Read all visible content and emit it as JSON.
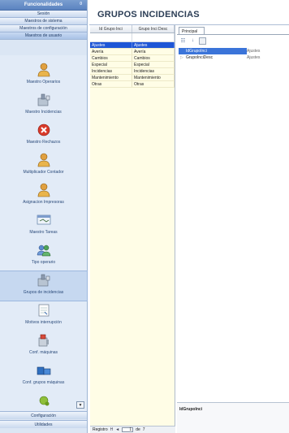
{
  "nav": {
    "header": "Funcionalidades",
    "header_pin": "0",
    "groups": [
      "Sesión",
      "Maestros de sistema",
      "Maestros de configuración",
      "Maestros de usuario"
    ],
    "items": [
      {
        "label": "Maestro Operarios",
        "icon": "user-icon"
      },
      {
        "label": "Maestro Incidencias",
        "icon": "incident-icon"
      },
      {
        "label": "Maestro Rechazos",
        "icon": "reject-icon"
      },
      {
        "label": "Multiplicador Contador",
        "icon": "user-icon"
      },
      {
        "label": "Asignacion Impresoras",
        "icon": "user-icon"
      },
      {
        "label": "Maestro Tareas",
        "icon": "tasks-icon"
      },
      {
        "label": "Tipo operario",
        "icon": "users-icon"
      },
      {
        "label": "Grupos de incidencias",
        "icon": "incident-groups-icon"
      },
      {
        "label": "Motivos interrupción",
        "icon": "document-icon"
      },
      {
        "label": "Conf. máquinas",
        "icon": "machine-icon"
      },
      {
        "label": "Conf. grupos máquinas",
        "icon": "machine-groups-icon"
      },
      {
        "label": "",
        "icon": "partial-icon"
      }
    ],
    "footer": [
      "Configuración",
      "Utilidades"
    ]
  },
  "page_title": "GRUPOS INCIDENCIAS",
  "grid": {
    "columns": [
      "Id Grupo Inci",
      "Grupo Inci Desc"
    ],
    "rows": [
      [
        "Ajustes",
        "Ajustes"
      ],
      [
        "Avería",
        "Avería"
      ],
      [
        "Cambios",
        "Cambios"
      ],
      [
        "Especial",
        "Especial"
      ],
      [
        "Incidencias",
        "Incidencias"
      ],
      [
        "Mantenimiento",
        "Mantenimiento"
      ],
      [
        "Otras",
        "Otras"
      ]
    ],
    "selected_row": 0,
    "pager": {
      "label": "Registro",
      "first": "H",
      "prev": "◄",
      "current": "1",
      "of_label": "de",
      "total": "7"
    }
  },
  "props": {
    "tab": "Principal",
    "rows": [
      {
        "name": "IdGrupoInci",
        "value": "Ajustes"
      },
      {
        "name": "GrupoInciDesc",
        "value": "Ajustes"
      }
    ],
    "description_title": "IdGrupoInci"
  },
  "colors": {
    "selection": "#1e56d6",
    "grid_bg": "#fffde6",
    "nav_bg": "#dbe6f4"
  }
}
